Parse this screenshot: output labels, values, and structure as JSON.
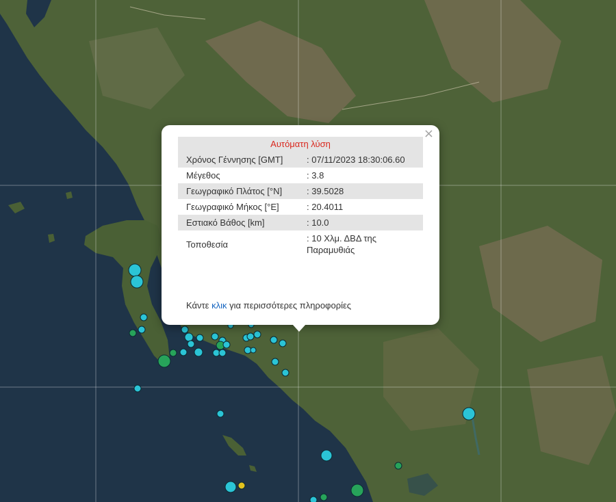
{
  "popup": {
    "title": "Αυτόματη λύση",
    "close": "×",
    "rows": [
      {
        "label": "Χρόνος Γέννησης [GMT]",
        "value": ": 07/11/2023 18:30:06.60"
      },
      {
        "label": "Μέγεθος",
        "value": ": 3.8"
      },
      {
        "label": "Γεωγραφικό Πλάτος [°N]",
        "value": ": 39.5028"
      },
      {
        "label": "Γεωγραφικό Μήκος [°E]",
        "value": ": 20.4011"
      },
      {
        "label": "Εστιακό Βάθος [km]",
        "value": ": 10.0"
      },
      {
        "label": "Τοποθεσία",
        "value": ": 10 Χλμ. ΔΒΔ της Παραμυθιάς"
      }
    ],
    "more_prefix": "Κάντε ",
    "more_link": "κλικ",
    "more_suffix": " για περισσότερες πληροφορίες"
  },
  "colors": {
    "sea": "#1f3448",
    "land": "#4e6238",
    "mountain": "#7b6e55",
    "quake_cyan": "#2bc4d6",
    "quake_green": "#27a35a",
    "quake_yellow": "#e2c21e"
  }
}
